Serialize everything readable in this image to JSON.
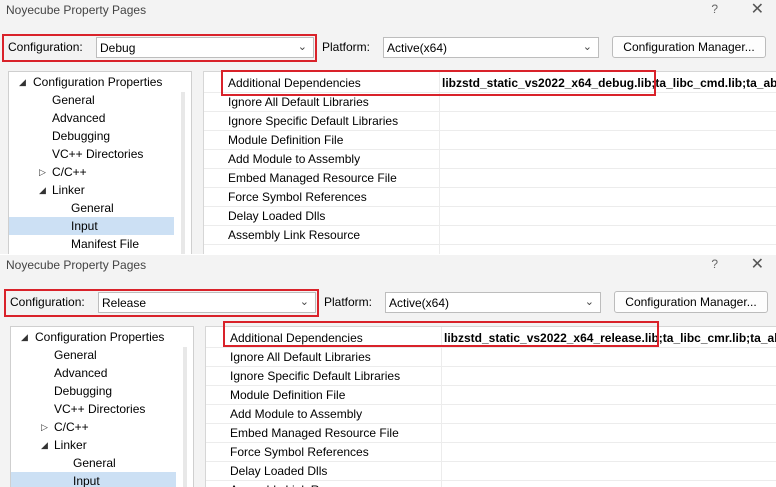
{
  "top": {
    "title": "Noyecube Property Pages",
    "help": "?",
    "close": "✕",
    "configuration_label": "Configuration:",
    "configuration_value": "Debug",
    "platform_label": "Platform:",
    "platform_value": "Active(x64)",
    "config_manager": "Configuration Manager...",
    "tree": [
      {
        "label": "Configuration Properties",
        "expanded": true
      },
      {
        "label": "General"
      },
      {
        "label": "Advanced"
      },
      {
        "label": "Debugging"
      },
      {
        "label": "VC++ Directories"
      },
      {
        "label": "C/C++",
        "expanded": false
      },
      {
        "label": "Linker",
        "expanded": true
      },
      {
        "label": "General"
      },
      {
        "label": "Input",
        "selected": true
      },
      {
        "label": "Manifest File"
      }
    ],
    "properties": [
      {
        "name": "Additional Dependencies",
        "value": "libzstd_static_vs2022_x64_debug.lib;ta_libc_cmd.lib;ta_ab"
      },
      {
        "name": "Ignore All Default Libraries",
        "value": ""
      },
      {
        "name": "Ignore Specific Default Libraries",
        "value": ""
      },
      {
        "name": "Module Definition File",
        "value": ""
      },
      {
        "name": "Add Module to Assembly",
        "value": ""
      },
      {
        "name": "Embed Managed Resource File",
        "value": ""
      },
      {
        "name": "Force Symbol References",
        "value": ""
      },
      {
        "name": "Delay Loaded Dlls",
        "value": ""
      },
      {
        "name": "Assembly Link Resource",
        "value": ""
      }
    ]
  },
  "bottom": {
    "title": "Noyecube Property Pages",
    "help": "?",
    "close": "✕",
    "configuration_label": "Configuration:",
    "configuration_value": "Release",
    "platform_label": "Platform:",
    "platform_value": "Active(x64)",
    "config_manager": "Configuration Manager...",
    "tree": [
      {
        "label": "Configuration Properties",
        "expanded": true
      },
      {
        "label": "General"
      },
      {
        "label": "Advanced"
      },
      {
        "label": "Debugging"
      },
      {
        "label": "VC++ Directories"
      },
      {
        "label": "C/C++",
        "expanded": false
      },
      {
        "label": "Linker",
        "expanded": true
      },
      {
        "label": "General"
      },
      {
        "label": "Input",
        "selected": true
      }
    ],
    "properties": [
      {
        "name": "Additional Dependencies",
        "value": "libzstd_static_vs2022_x64_release.lib;ta_libc_cmr.lib;ta_ab"
      },
      {
        "name": "Ignore All Default Libraries",
        "value": ""
      },
      {
        "name": "Ignore Specific Default Libraries",
        "value": ""
      },
      {
        "name": "Module Definition File",
        "value": ""
      },
      {
        "name": "Add Module to Assembly",
        "value": ""
      },
      {
        "name": "Embed Managed Resource File",
        "value": ""
      },
      {
        "name": "Force Symbol References",
        "value": ""
      },
      {
        "name": "Delay Loaded Dlls",
        "value": ""
      },
      {
        "name": "Assembly Link Resource",
        "value": ""
      }
    ]
  },
  "colors": {
    "highlight": "#d9222a",
    "selection": "#cce0f4"
  }
}
